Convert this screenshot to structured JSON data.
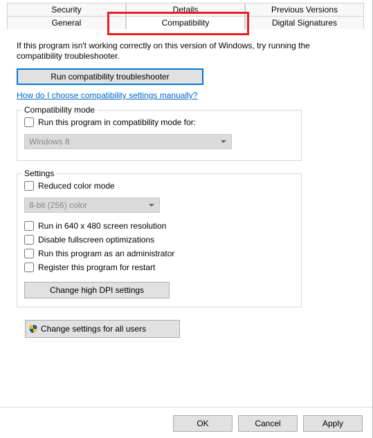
{
  "tabs": {
    "row1": [
      "Security",
      "Details",
      "Previous Versions"
    ],
    "row2": [
      "General",
      "Compatibility",
      "Digital Signatures"
    ],
    "selected": "Compatibility"
  },
  "intro": "If this program isn't working correctly on this version of Windows, try running the compatibility troubleshooter.",
  "run_button": "Run compatibility troubleshooter",
  "manual_link": "How do I choose compatibility settings manually?",
  "compat_group": {
    "title": "Compatibility mode",
    "checkbox": "Run this program in compatibility mode for:",
    "select_value": "Windows 8"
  },
  "settings_group": {
    "title": "Settings",
    "reduced_color": "Reduced color mode",
    "color_value": "8-bit (256) color",
    "run640": "Run in 640 x 480 screen resolution",
    "disable_fs": "Disable fullscreen optimizations",
    "admin": "Run this program as an administrator",
    "register": "Register this program for restart",
    "dpi_button": "Change high DPI settings"
  },
  "all_users_button": "Change settings for all users",
  "footer": {
    "ok": "OK",
    "cancel": "Cancel",
    "apply": "Apply"
  }
}
